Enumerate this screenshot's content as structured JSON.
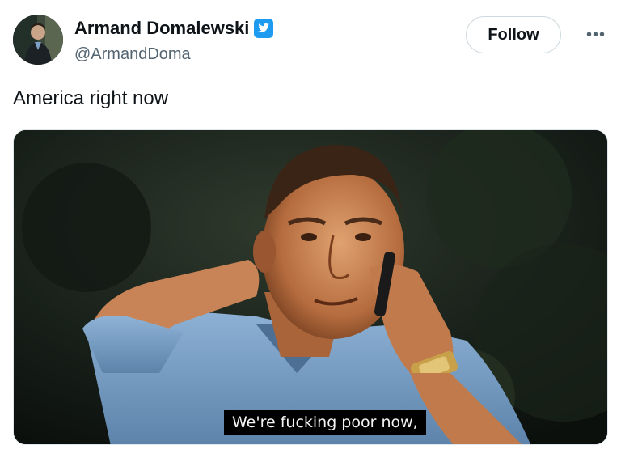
{
  "tweet": {
    "author_name": "Armand Domalewski",
    "author_handle": "@ArmandDoma",
    "verified_icon": "twitter-bird-verified-icon",
    "follow_label": "Follow",
    "more_label": "•••",
    "text": "America right now"
  },
  "media": {
    "subtitle": "We're fucking poor now,"
  },
  "colors": {
    "text_primary": "#0f1419",
    "text_secondary": "#536471",
    "verified_blue": "#1d9bf0",
    "follow_border": "#cfd9de"
  }
}
